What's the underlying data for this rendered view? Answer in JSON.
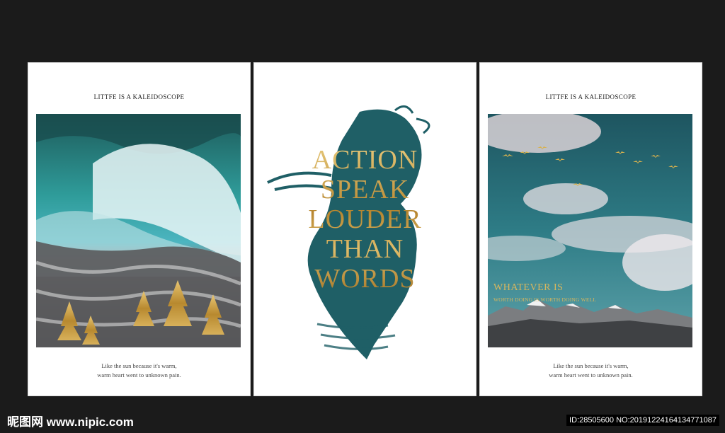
{
  "left_card": {
    "title": "LITTFE IS A KALEIDOSCOPE",
    "caption_line1": "Like the sun because it's warm,",
    "caption_line2": "warm heart went to unknown pain."
  },
  "middle_card": {
    "quote_lines": [
      "ACTION",
      "SPEAK",
      "LOUDER",
      "THAN",
      "WORDS"
    ]
  },
  "right_card": {
    "title": "LITTFE IS A KALEIDOSCOPE",
    "overlay_title": "WHATEVER IS",
    "overlay_subtitle": "WORTH DOING IS WORTH DOING WELL",
    "caption_line1": "Like the sun because it's warm,",
    "caption_line2": "warm heart went to unknown pain."
  },
  "watermark": {
    "site": "昵图网 www.nipic.com",
    "id_text": "ID:28505600 NO:20191224164134771087"
  },
  "colors": {
    "background": "#1b1b1b",
    "gold": "#c8a24b",
    "teal": "#1f5f66",
    "card": "#ffffff"
  }
}
